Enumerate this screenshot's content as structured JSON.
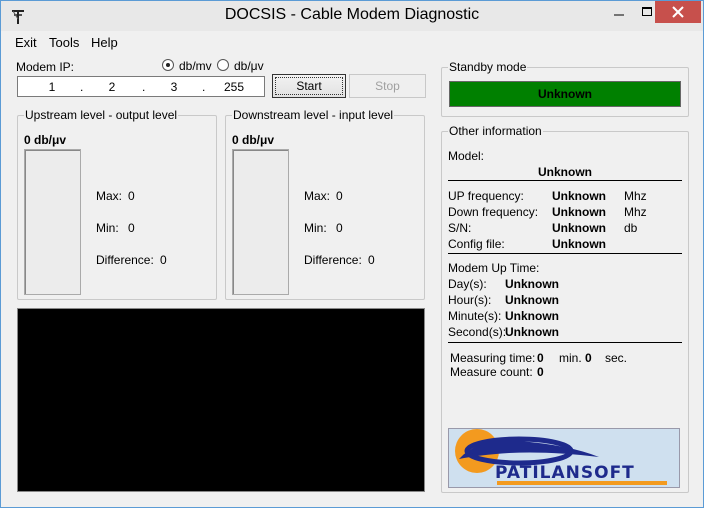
{
  "window": {
    "title": "DOCSIS - Cable Modem Diagnostic"
  },
  "menu": [
    "Exit",
    "Tools",
    "Help"
  ],
  "modem": {
    "ip_label": "Modem IP:",
    "unit_options": [
      "db/mv",
      "db/μv"
    ],
    "selected_unit": "db/mv",
    "ip": [
      "1",
      "2",
      "3",
      "255"
    ],
    "start_label": "Start",
    "stop_label": "Stop"
  },
  "upstream": {
    "title": "Upstream level - output level",
    "value": "0 db/μv",
    "max_label": "Max:",
    "max": "0",
    "min_label": "Min:",
    "min": "0",
    "diff_label": "Difference:",
    "diff": "0"
  },
  "downstream": {
    "title": "Downstream level - input level",
    "value": "0 db/μv",
    "max_label": "Max:",
    "max": "0",
    "min_label": "Min:",
    "min": "0",
    "diff_label": "Difference:",
    "diff": "0"
  },
  "standby": {
    "title": "Standby mode",
    "status": "Unknown",
    "status_color": "#008000"
  },
  "info": {
    "title": "Other information",
    "model_label": "Model:",
    "model": "Unknown",
    "rows": [
      {
        "label": "UP frequency:",
        "value": "Unknown",
        "unit": "Mhz"
      },
      {
        "label": "Down frequency:",
        "value": "Unknown",
        "unit": "Mhz"
      },
      {
        "label": "S/N:",
        "value": "Unknown",
        "unit": "db"
      },
      {
        "label": "Config file:",
        "value": "Unknown",
        "unit": ""
      }
    ],
    "uptime_title": "Modem Up Time:",
    "uptime": [
      {
        "label": "Day(s):",
        "value": "Unknown"
      },
      {
        "label": "Hour(s):",
        "value": "Unknown"
      },
      {
        "label": "Minute(s):",
        "value": "Unknown"
      },
      {
        "label": "Second(s):",
        "value": "Unknown"
      }
    ],
    "measuring_label": "Measuring time:",
    "measuring_min": "0",
    "min_label": "min.",
    "measuring_sec": "0",
    "sec_label": "sec.",
    "count_label": "Measure count:",
    "count": "0"
  },
  "logo_text": "PATILANSOFT"
}
